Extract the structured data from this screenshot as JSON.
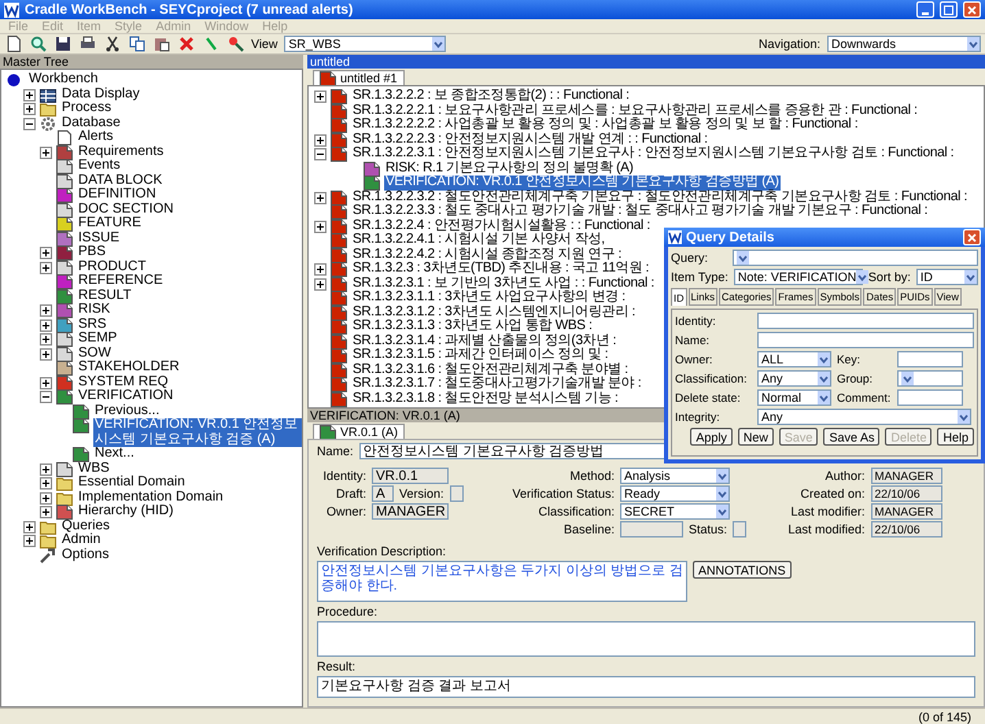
{
  "window": {
    "title": "Cradle WorkBench - SEYCproject (7 unread alerts)"
  },
  "menu": [
    "File",
    "Edit",
    "Item",
    "Style",
    "Admin",
    "Window",
    "Help"
  ],
  "toolbar": {
    "view_label": "View",
    "view": "SR_WBS",
    "navigation_label": "Navigation:",
    "navigation": "Downwards"
  },
  "tree": {
    "title": "Master Tree",
    "items": [
      {
        "label": "Workbench",
        "kind": "dot",
        "color": "#1010c0",
        "selected": false,
        "children": [
          {
            "label": "Data Display",
            "kind": "table",
            "color": "#3a5a8c",
            "expanded": false,
            "selected": false
          },
          {
            "label": "Process",
            "kind": "folder",
            "color": "#e8d36a",
            "expanded": false,
            "selected": false
          },
          {
            "label": "Database",
            "kind": "gear",
            "color": "#707070",
            "expanded": true,
            "selected": false,
            "children": [
              {
                "label": "Alerts",
                "kind": "doc",
                "selected": false
              },
              {
                "label": "Requirements",
                "kind": "note",
                "color": "#b04040",
                "expanded": false,
                "selected": false
              },
              {
                "label": "Events",
                "kind": "note",
                "color": "#d8d8d8",
                "selected": false
              },
              {
                "label": "DATA BLOCK",
                "kind": "note",
                "color": "#d8d8d8",
                "selected": false
              },
              {
                "label": "DEFINITION",
                "kind": "note",
                "color": "#c020c0",
                "selected": false
              },
              {
                "label": "DOC SECTION",
                "kind": "note",
                "color": "#d8d8d8",
                "selected": false
              },
              {
                "label": "FEATURE",
                "kind": "note",
                "color": "#d8d020",
                "selected": false
              },
              {
                "label": "ISSUE",
                "kind": "note",
                "color": "#b070c0",
                "selected": false
              },
              {
                "label": "PBS",
                "kind": "note",
                "color": "#902040",
                "expanded": false,
                "selected": false
              },
              {
                "label": "PRODUCT",
                "kind": "note",
                "color": "#d8d8d8",
                "expanded": false,
                "selected": false
              },
              {
                "label": "REFERENCE",
                "kind": "note",
                "color": "#c020c0",
                "selected": false
              },
              {
                "label": "RESULT",
                "kind": "note",
                "color": "#309040",
                "selected": false
              },
              {
                "label": "RISK",
                "kind": "note",
                "color": "#b050b0",
                "expanded": false,
                "selected": false
              },
              {
                "label": "SRS",
                "kind": "note",
                "color": "#40a0c0",
                "expanded": false,
                "selected": false
              },
              {
                "label": "SEMP",
                "kind": "note",
                "color": "#d8d8d8",
                "expanded": false,
                "selected": false
              },
              {
                "label": "SOW",
                "kind": "note",
                "color": "#d8d8d8",
                "expanded": false,
                "selected": false
              },
              {
                "label": "STAKEHOLDER",
                "kind": "note",
                "color": "#c8b090",
                "selected": false
              },
              {
                "label": "SYSTEM REQ",
                "kind": "note",
                "color": "#d03020",
                "expanded": false,
                "selected": false
              },
              {
                "label": "VERIFICATION",
                "kind": "note",
                "color": "#309040",
                "expanded": true,
                "selected": false,
                "children": [
                  {
                    "label": "Previous...",
                    "kind": "note",
                    "color": "#309040",
                    "selected": false
                  },
                  {
                    "label": "VERIFICATION: VR.0.1 안전정보시스템 기본요구사항 검증 (A)",
                    "kind": "note",
                    "color": "#309040",
                    "selected": true
                  },
                  {
                    "label": "Next...",
                    "kind": "note",
                    "color": "#309040",
                    "selected": false
                  }
                ]
              },
              {
                "label": "WBS",
                "kind": "note",
                "color": "#d8d8d8",
                "expanded": false,
                "selected": false
              },
              {
                "label": "Essential Domain",
                "kind": "folder",
                "color": "#e8d36a",
                "expanded": false,
                "selected": false
              },
              {
                "label": "Implementation Domain",
                "kind": "folder",
                "color": "#e8d36a",
                "expanded": false,
                "selected": false
              },
              {
                "label": "Hierarchy (HID)",
                "kind": "note",
                "color": "#d05050",
                "expanded": false,
                "selected": false
              }
            ]
          },
          {
            "label": "Queries",
            "kind": "folder",
            "color": "#e8d36a",
            "expanded": false,
            "selected": false
          },
          {
            "label": "Admin",
            "kind": "folder",
            "color": "#e8d36a",
            "expanded": false,
            "selected": false
          },
          {
            "label": "Options",
            "kind": "tool",
            "color": "#505050",
            "selected": false
          }
        ]
      }
    ]
  },
  "document": {
    "title": "untitled",
    "tab": "untitled #1",
    "rows": [
      {
        "text": "SR.1.3.2.2.2 : 보 종합조정통합(2) : : Functional :",
        "color": "#cc2200",
        "expanded": false,
        "selected": false
      },
      {
        "text": "SR.1.3.2.2.2.1 : 보요구사항관리 프로세스를 : 보요구사항관리 프로세스를 증용한 관 : Functional :",
        "color": "#cc2200",
        "selected": false
      },
      {
        "text": "SR.1.3.2.2.2.2 : 사업총괄 보 활용 정의 및 : 사업총괄 보 활용 정의 및 보 할 : Functional :",
        "color": "#cc2200",
        "selected": false
      },
      {
        "text": "SR.1.3.2.2.2.3 : 안전정보지원시스템 개발 연계 : : Functional :",
        "color": "#cc2200",
        "expanded": false,
        "selected": false
      },
      {
        "text": "SR.1.3.2.2.3.1 : 안전정보지원시스템 기본요구사 : 안전정보지원시스템 기본요구사항 검토 : Functional :",
        "color": "#cc2200",
        "expanded": true,
        "selected": false,
        "children": [
          {
            "text": "RISK: R.1 기본요구사항의 정의 불명확 (A)",
            "color": "#b050b0",
            "selected": false
          },
          {
            "text": "VERIFICATION: VR.0.1 안전정보시스템 기본요구사항 검증방법 (A)",
            "color": "#309040",
            "selected": true
          }
        ]
      },
      {
        "text": "SR.1.3.2.2.3.2 : 철도안전관리체계구축 기본요구 : 철도안전관리체계구축 기본요구사항 검토 : Functional :",
        "color": "#cc2200",
        "expanded": false,
        "selected": false
      },
      {
        "text": "SR.1.3.2.2.3.3 : 철도 중대사고 평가기술 개발 : 철도 중대사고 평가기술 개발 기본요구 : Functional :",
        "color": "#cc2200",
        "selected": false
      },
      {
        "text": "SR.1.3.2.2.4 : 안전평가시험시설활용 : : Functional :",
        "color": "#cc2200",
        "expanded": false,
        "selected": false
      },
      {
        "text": "SR.1.3.2.2.4.1 : 시험시설 기본 사양서 작성,",
        "color": "#cc2200",
        "selected": false
      },
      {
        "text": "SR.1.3.2.2.4.2 : 시험시설 종합조정 지원 연구 :",
        "color": "#cc2200",
        "selected": false
      },
      {
        "text": "SR.1.3.2.3 : 3차년도(TBD) 추진내용 : 국고 11억원 :",
        "color": "#cc2200",
        "expanded": false,
        "selected": false
      },
      {
        "text": "SR.1.3.2.3.1 : 보 기반의 3차년도 사업 : : Functional :",
        "color": "#cc2200",
        "expanded": false,
        "selected": false
      },
      {
        "text": "SR.1.3.2.3.1.1 : 3차년도 사업요구사항의 변경 :",
        "color": "#cc2200",
        "selected": false
      },
      {
        "text": "SR.1.3.2.3.1.2 : 3차년도 시스템엔지니어링관리 :",
        "color": "#cc2200",
        "selected": false
      },
      {
        "text": "SR.1.3.2.3.1.3 : 3차년도 사업 통합 WBS :",
        "color": "#cc2200",
        "selected": false
      },
      {
        "text": "SR.1.3.2.3.1.4 : 과제별 산출물의 정의(3차년 :",
        "color": "#cc2200",
        "selected": false
      },
      {
        "text": "SR.1.3.2.3.1.5 : 과제간 인터페이스 정의 및 :",
        "color": "#cc2200",
        "selected": false
      },
      {
        "text": "SR.1.3.2.3.1.6 : 철도안전관리체계구축 분야별 :",
        "color": "#cc2200",
        "selected": false
      },
      {
        "text": "SR.1.3.2.3.1.7 : 철도중대사고평가기술개발 분야 :",
        "color": "#cc2200",
        "selected": false
      },
      {
        "text": "SR.1.3.2.3.1.8 : 철도안전망 분석시스템 기능 :",
        "color": "#cc2200",
        "selected": false
      }
    ]
  },
  "detail": {
    "title": "VERIFICATION: VR.0.1 (A)",
    "tab": "VR.0.1 (A)",
    "name_label": "Name:",
    "name": "안전정보시스템 기본요구사항 검증방법",
    "identity_label": "Identity:",
    "identity": "VR.0.1",
    "draft_label": "Draft:",
    "draft": "A",
    "version_label": "Version:",
    "owner_label": "Owner:",
    "owner": "MANAGER",
    "method_label": "Method:",
    "method": "Analysis",
    "status_label": "Verification Status:",
    "status": "Ready",
    "classification_label": "Classification:",
    "classification": "SECRET",
    "baseline_label": "Baseline:",
    "state_label": "Status:",
    "info": [
      {
        "label": "Author:",
        "value": "MANAGER"
      },
      {
        "label": "Created on:",
        "value": "22/10/06"
      },
      {
        "label": "Last modifier:",
        "value": "MANAGER"
      },
      {
        "label": "Last modified:",
        "value": "22/10/06"
      }
    ],
    "description_label": "Verification Description:",
    "description": "안전정보시스템 기본요구사항은 두가지 이상의 방법으로 검증해야 한다.",
    "annotations": "ANNOTATIONS",
    "procedure_label": "Procedure:",
    "result_label": "Result:",
    "result": "기본요구사항 검증 결과 보고서"
  },
  "query_dialog": {
    "title": "Query Details",
    "query_label": "Query:",
    "item_type_label": "Item Type:",
    "item_type": "Note: VERIFICATION",
    "sort_label": "Sort by:",
    "sort": "ID",
    "tabs": [
      {
        "label": "ID",
        "selected": true
      },
      {
        "label": "Links",
        "selected": false
      },
      {
        "label": "Categories",
        "selected": false
      },
      {
        "label": "Frames",
        "selected": false
      },
      {
        "label": "Symbols",
        "selected": false
      },
      {
        "label": "Dates",
        "selected": false
      },
      {
        "label": "PUIDs",
        "selected": false
      },
      {
        "label": "View",
        "selected": false
      }
    ],
    "rows": [
      [
        {
          "label": "Identity:",
          "kind": "text"
        }
      ],
      [
        {
          "label": "Name:",
          "kind": "text"
        }
      ],
      [
        {
          "label": "Owner:",
          "kind": "combo",
          "value": "ALL"
        },
        {
          "label": "Key:",
          "kind": "text"
        }
      ],
      [
        {
          "label": "Classification:",
          "kind": "combo",
          "value": "Any"
        },
        {
          "label": "Group:",
          "kind": "combo"
        }
      ],
      [
        {
          "label": "Delete state:",
          "kind": "combo",
          "value": "Normal"
        },
        {
          "label": "Comment:",
          "kind": "text"
        }
      ],
      [
        {
          "label": "Integrity:",
          "kind": "combo",
          "value": "Any"
        }
      ]
    ],
    "buttons": [
      {
        "label": "Apply",
        "disabled": false
      },
      {
        "label": "New",
        "disabled": false
      },
      {
        "label": "Save",
        "disabled": true
      },
      {
        "label": "Save As",
        "disabled": false
      },
      {
        "label": "Delete",
        "disabled": true
      },
      {
        "label": "Help",
        "disabled": false
      }
    ]
  },
  "status_bar": {
    "count": "(0 of 145)"
  }
}
